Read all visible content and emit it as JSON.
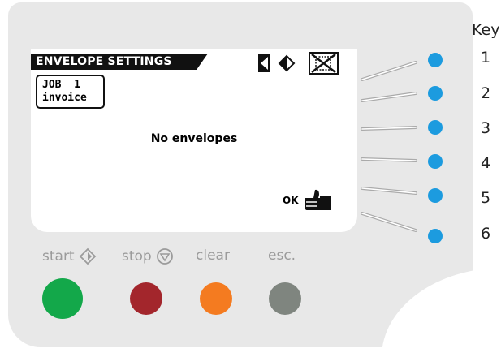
{
  "screen": {
    "title": "ENVELOPE SETTINGS",
    "job_line1": "JOB  1",
    "job_line2": "invoice",
    "message": "No envelopes",
    "ok_label": "OK"
  },
  "status_icons": [
    "left-arrow-icon",
    "single-sided-icon",
    "crossed-out-icon"
  ],
  "key_legend": {
    "header": "Key",
    "keys": [
      "1",
      "2",
      "3",
      "4",
      "5",
      "6"
    ]
  },
  "control_buttons": {
    "start": {
      "label": "start",
      "icon": "start-diamond-icon",
      "color": "#13a84a"
    },
    "stop": {
      "label": "stop",
      "icon": "stop-triangle-icon",
      "color": "#a3262c"
    },
    "clear": {
      "label": "clear",
      "color": "#f47b20"
    },
    "esc": {
      "label": "esc.",
      "color": "#7f857f"
    }
  },
  "colors": {
    "panel": "#e8e8e8",
    "side_key": "#1c9bdf",
    "label_gray": "#9b9b9b"
  }
}
